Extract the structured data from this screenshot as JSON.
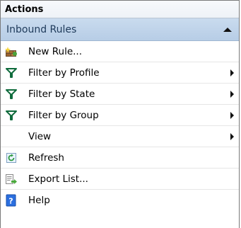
{
  "panel": {
    "title": "Actions"
  },
  "section": {
    "title": "Inbound Rules",
    "expanded": true
  },
  "items": [
    {
      "label": "New Rule...",
      "icon": "new-rule-icon",
      "submenu": false
    },
    {
      "label": "Filter by Profile",
      "icon": "filter-icon",
      "submenu": true
    },
    {
      "label": "Filter by State",
      "icon": "filter-icon",
      "submenu": true
    },
    {
      "label": "Filter by Group",
      "icon": "filter-icon",
      "submenu": true
    },
    {
      "label": "View",
      "icon": "",
      "submenu": true
    },
    {
      "label": "Refresh",
      "icon": "refresh-icon",
      "submenu": false
    },
    {
      "label": "Export List...",
      "icon": "export-list-icon",
      "submenu": false
    },
    {
      "label": "Help",
      "icon": "help-icon",
      "submenu": false
    }
  ],
  "colors": {
    "section_bg": "#c0d4ea",
    "section_text": "#1e3a5a",
    "filter_icon": "#0f6b3c",
    "help_icon": "#1f5fd1",
    "refresh_icon": "#2f9a3e"
  }
}
